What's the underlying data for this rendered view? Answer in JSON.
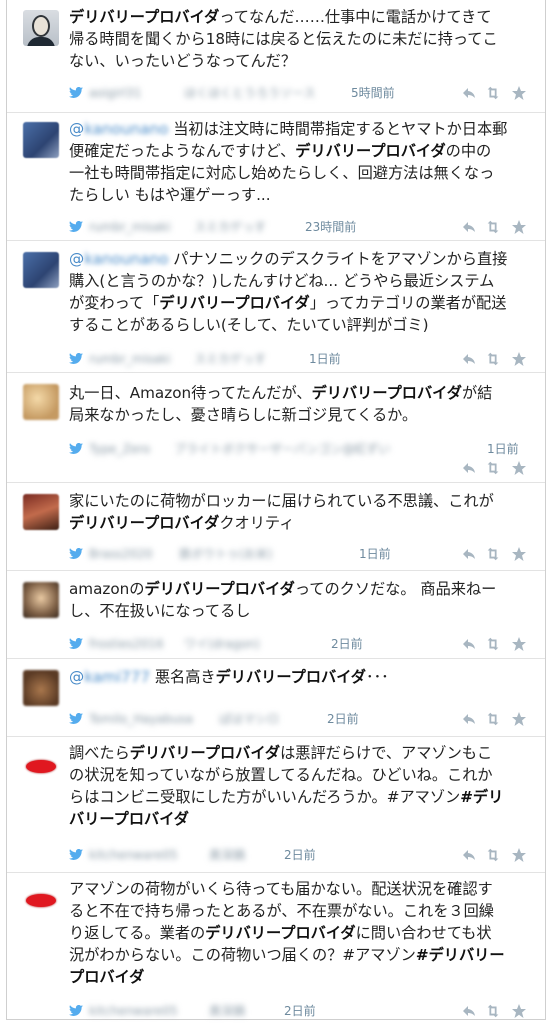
{
  "tweets": [
    {
      "avatar": "face-avatar",
      "parts": [
        {
          "t": "デリバリープロバイダ",
          "b": true
        },
        {
          "t": "ってなんだ……仕事中に電話かけてきて\n帰る時間を聞くから18時には戻ると伝えたのに未だに持ってこ\nない、いったいどうなってんだ？"
        }
      ],
      "handle": "aoigirl31",
      "name2": "ほくほくとうろうソース",
      "time": "5時間前"
    },
    {
      "avatar": "blue-avatar",
      "parts": [
        {
          "t": "@kanounano",
          "m": true
        },
        {
          "t": " 当初は注文時に時間帯指定するとヤマトか日本郵\n便確定だったようなんですけど、"
        },
        {
          "t": "デリバリープロバイダ",
          "b": true
        },
        {
          "t": "の中の\n一社も時間帯指定に対応し始めたらしく、回避方法は無くなっ\nたらしい もはや運ゲーっす..."
        }
      ],
      "handle": "rumbr_misaki",
      "name2": "スミカゲっす",
      "time": "23時間前"
    },
    {
      "avatar": "blue-avatar",
      "parts": [
        {
          "t": "@kanounano",
          "m": true
        },
        {
          "t": " パナソニックのデスクライトをアマゾンから直接\n購入(と言うのかな？)したんすけどね... どうやら最近システム\nが変わって「"
        },
        {
          "t": "デリバリープロバイダ",
          "b": true
        },
        {
          "t": "」ってカテゴリの業者が配送\nすることがあるらしい(そして、たいてい評判がゴミ)"
        }
      ],
      "handle": "rumbr_misaki",
      "name2": "スミカゲっす",
      "time": "1日前"
    },
    {
      "avatar": "sand-avatar",
      "parts": [
        {
          "t": "丸一日、Amazon待ってたんだが、"
        },
        {
          "t": "デリバリープロバイダ",
          "b": true
        },
        {
          "t": "が結\n局来なかったし、憂さ晴らしに新ゴジ見てくるか。"
        }
      ],
      "handle": "Type_Zero",
      "name2": "ブライトボクサーザーパンゴン@紅ずい",
      "time": "1日前"
    },
    {
      "avatar": "red-avatar",
      "parts": [
        {
          "t": "家にいたのに荷物がロッカーに届けられている不思議、これが\n"
        },
        {
          "t": "デリバリープロバイダ",
          "b": true
        },
        {
          "t": "クオリティ"
        }
      ],
      "handle": "Brass2020",
      "name2": "鉄ボウトゥ(お米)",
      "time": "1日前"
    },
    {
      "avatar": "photo-avatar",
      "parts": [
        {
          "t": "amazonの"
        },
        {
          "t": "デリバリープロバイダ",
          "b": true
        },
        {
          "t": "ってのクソだな。 商品来ねー\nし、不在扱いになってるし"
        }
      ],
      "handle": "frosties2016",
      "name2": "ワイ(dragon)",
      "time": "2日前"
    },
    {
      "avatar": "cat-avatar",
      "parts": [
        {
          "t": "@kami777",
          "m": true
        },
        {
          "t": " 悪名高き"
        },
        {
          "t": "デリバリープロバイダ",
          "b": true
        },
        {
          "t": "･･･"
        }
      ],
      "handle": "Tomilo_Hayabusa",
      "name2": "ぱはマシロ",
      "time": "2日前"
    },
    {
      "avatar": "lips-avatar",
      "parts": [
        {
          "t": "調べたら"
        },
        {
          "t": "デリバリープロバイダ",
          "b": true
        },
        {
          "t": "は悪評だらけで、アマゾンもこ\nの状況を知っていながら放置してるんだね。ひどいね。これか\nらはコンビニ受取にした方がいいんだろうか。#アマゾン"
        },
        {
          "t": "#デリ\nバリープロバイダ",
          "b": true
        }
      ],
      "handle": "kitchenware05",
      "name2": "奥深鍋",
      "time": "2日前"
    },
    {
      "avatar": "lips-avatar",
      "parts": [
        {
          "t": "アマゾンの荷物がいくら待っても届かない。配送状況を確認す\nると不在で持ち帰ったとあるが、不在票がない。これを３回繰\nり返してる。業者の"
        },
        {
          "t": "デリバリープロバイダ",
          "b": true
        },
        {
          "t": "に問い合わせても状\n況がわからない。この荷物いつ届くの？#アマゾン"
        },
        {
          "t": "#デリバリー\nプロバイダ",
          "b": true
        }
      ],
      "handle": "kitchenware05",
      "name2": "奥深鍋",
      "time": "2日前"
    }
  ],
  "icons": {
    "bird": "twitter-bird-icon",
    "reply": "reply-icon",
    "retweet": "retweet-icon",
    "favorite": "favorite-icon"
  },
  "colors": {
    "meta": "#8899a6",
    "mention": "#4a8cc9",
    "bird": "#55acee"
  }
}
